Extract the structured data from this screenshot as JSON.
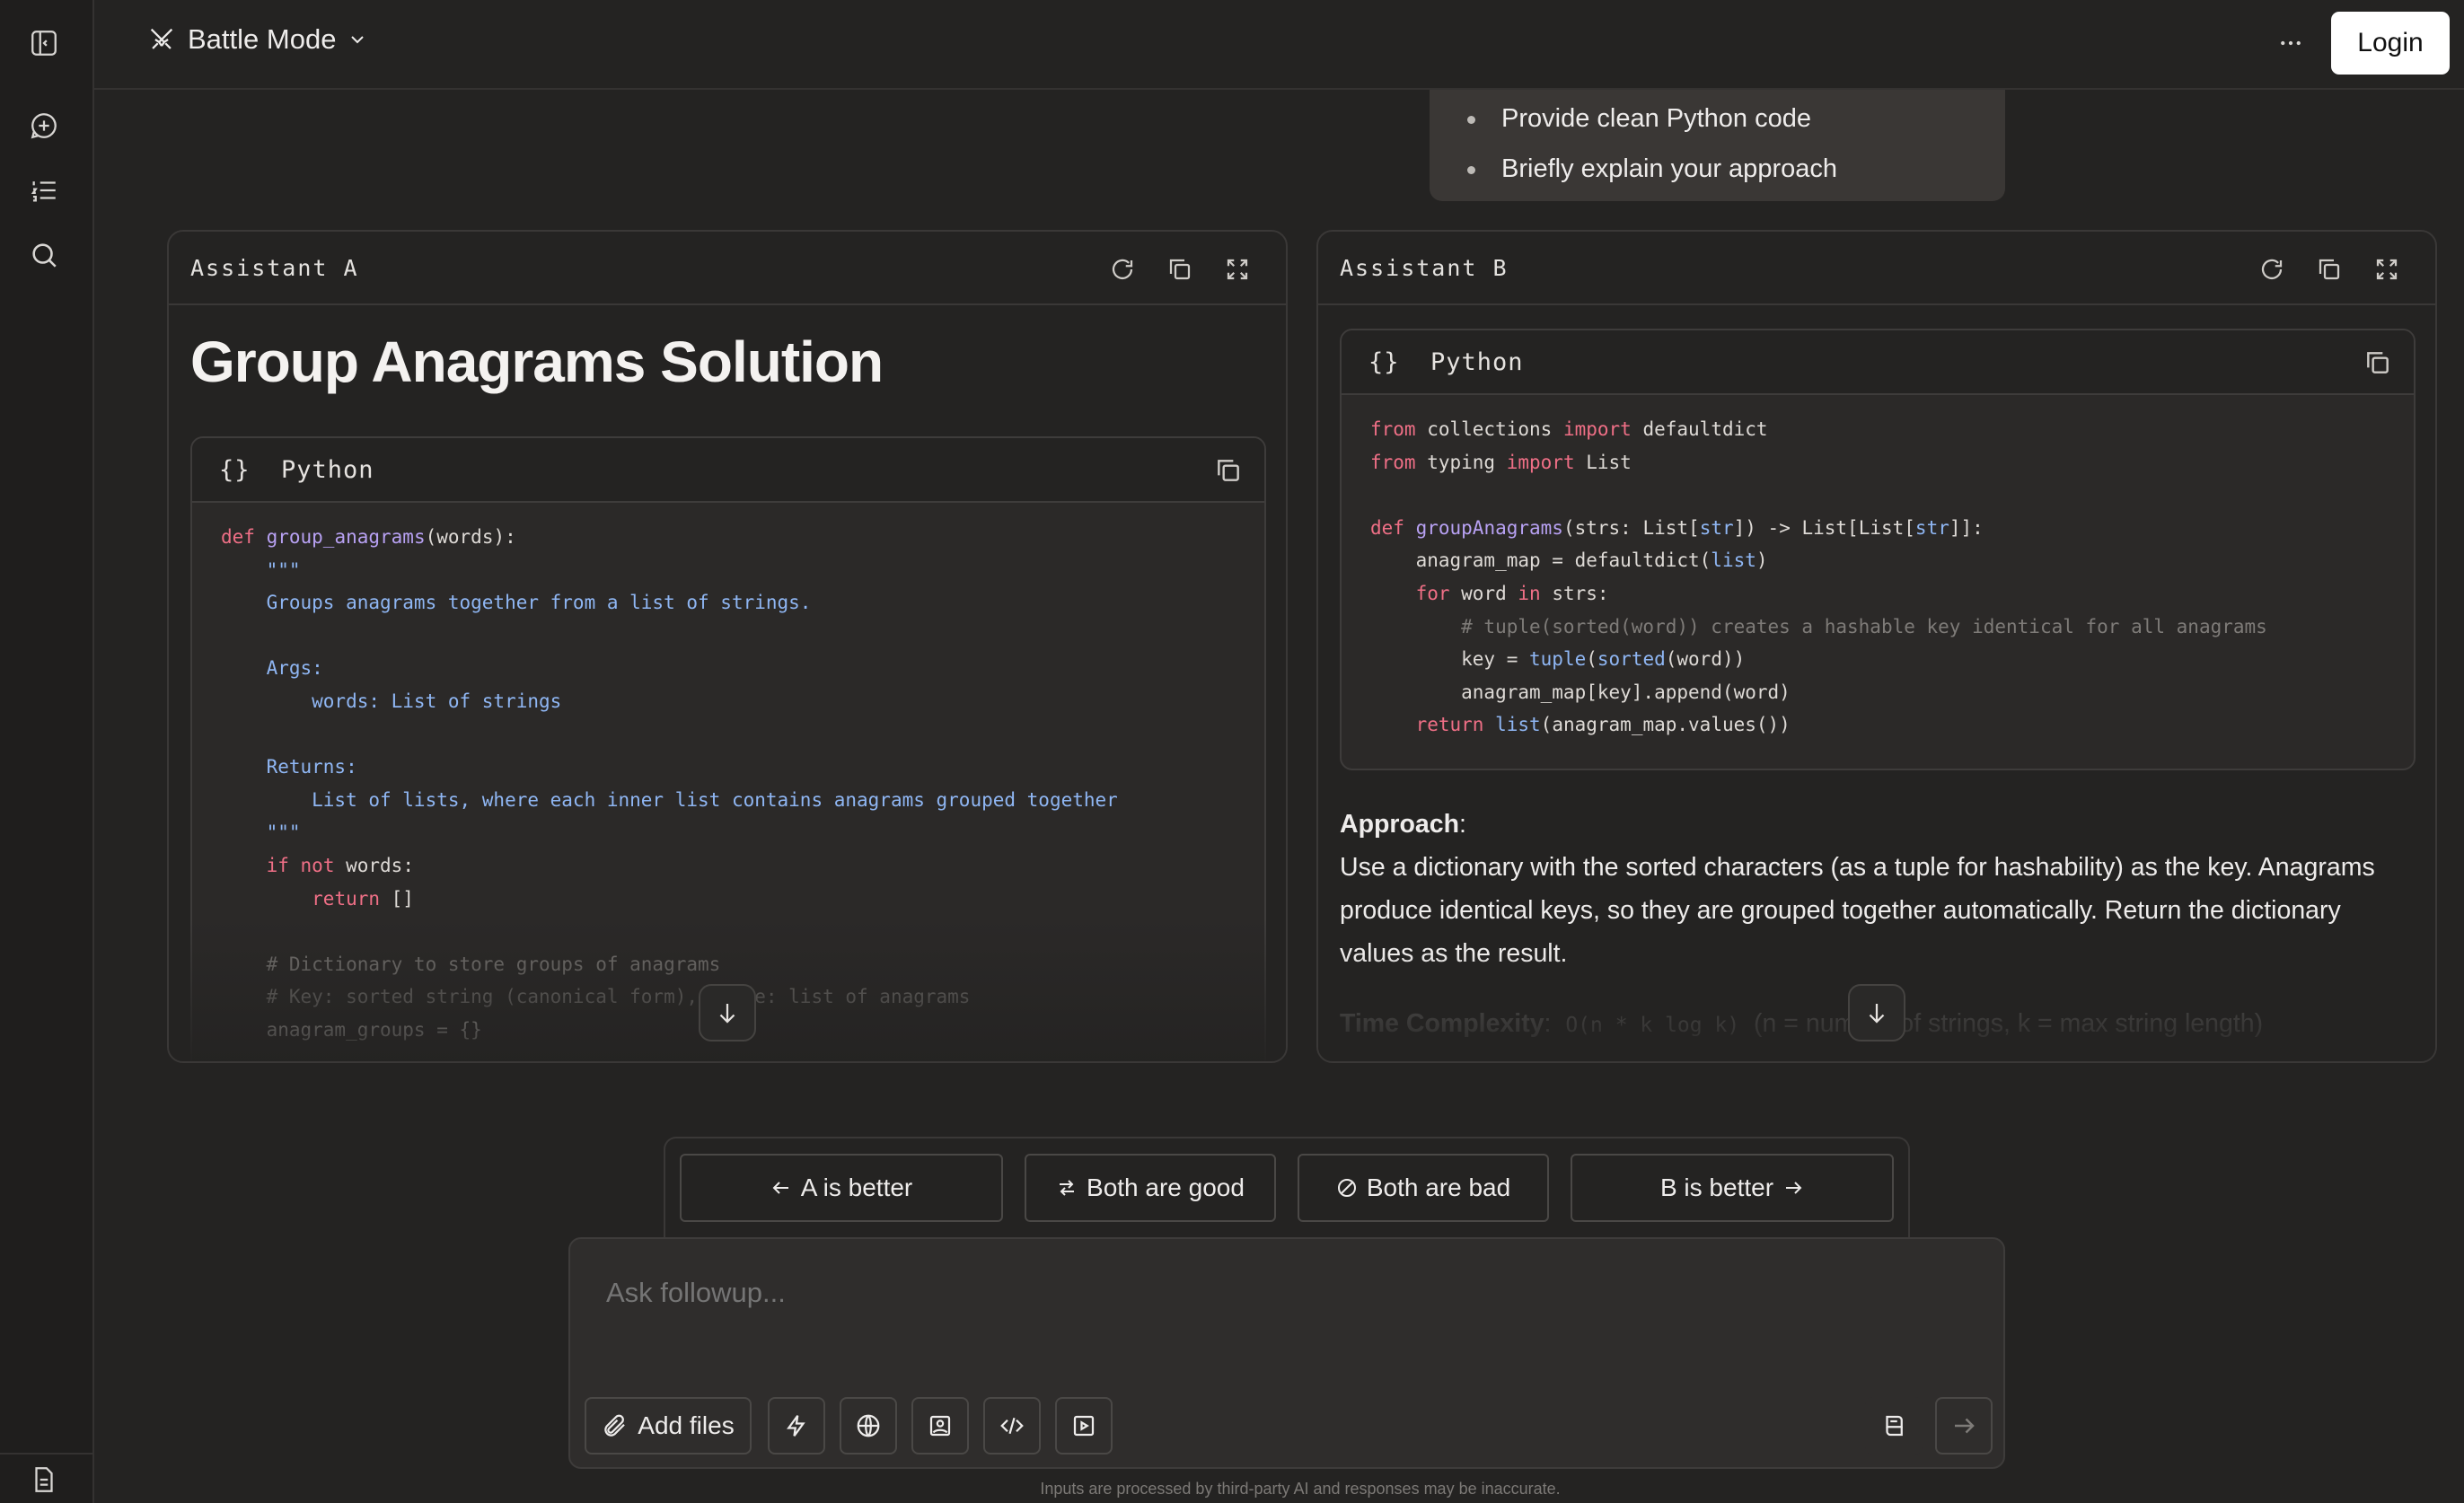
{
  "header": {
    "mode_label": "Battle Mode",
    "login_label": "Login"
  },
  "user_message": {
    "bullets": [
      "Provide clean Python code",
      "Briefly explain your approach"
    ]
  },
  "panel_a": {
    "title": "Assistant A",
    "heading": "Group Anagrams Solution",
    "code_lang": "Python"
  },
  "panel_b": {
    "title": "Assistant B",
    "code_lang": "Python",
    "approach_label": "Approach",
    "approach_text": "Use a dictionary with the sorted characters (as a tuple for hashability) as the key. Anagrams produce identical keys, so they are grouped together automatically. Return the dictionary values as the result.",
    "time_label": "Time Complexity",
    "time_value": "O(n * k log k)",
    "time_note": "(n = number of strings, k = max string length)"
  },
  "vote": {
    "a_better": "A is better",
    "both_good": "Both are good",
    "both_bad": "Both are bad",
    "b_better": "B is better"
  },
  "composer": {
    "placeholder": "Ask followup...",
    "add_files": "Add files"
  },
  "disclaimer": "Inputs are processed by third-party AI and responses may be inaccurate.",
  "colors": {
    "background": "#242322",
    "keyword": "#ef6f86",
    "function": "#b8a1f3",
    "string": "#8fb6f3"
  }
}
